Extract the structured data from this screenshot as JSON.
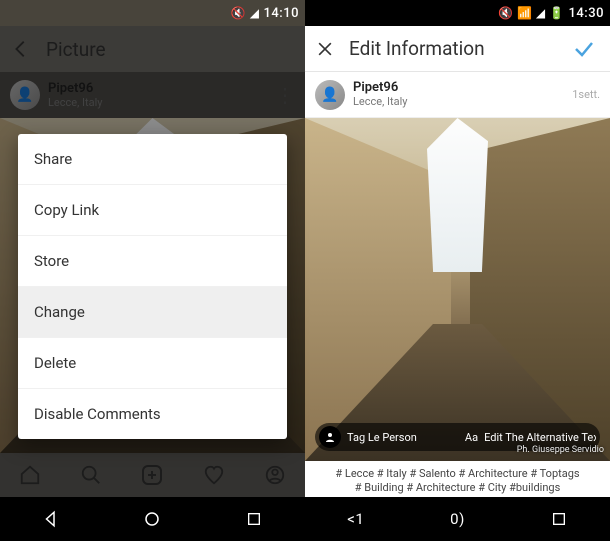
{
  "left": {
    "status_time": "14:10",
    "appbar_title": "Picture",
    "user": {
      "name": "Pipet96",
      "location": "Lecce, Italy"
    },
    "menu": {
      "share": "Share",
      "copylink": "Copy Link",
      "store": "Store",
      "change": "Change",
      "delete": "Delete",
      "disable": "Disable Comments"
    }
  },
  "right": {
    "status_time": "14:30",
    "appbar_title": "Edit Information",
    "user": {
      "name": "Pipet96",
      "location": "Lecce, Italy"
    },
    "post_time": "1sett.",
    "tagbar": {
      "tag_people": "Tag Le Person",
      "alt_label": "Aa",
      "alt_text": "Edit The Alternative Text"
    },
    "photo_credit": "Ph. Giuseppe Servidio",
    "caption_line1": "# Lecce # Italy # Salento # Architecture # Toptags",
    "caption_line2": "# Building # Architecture # City #buildings"
  }
}
